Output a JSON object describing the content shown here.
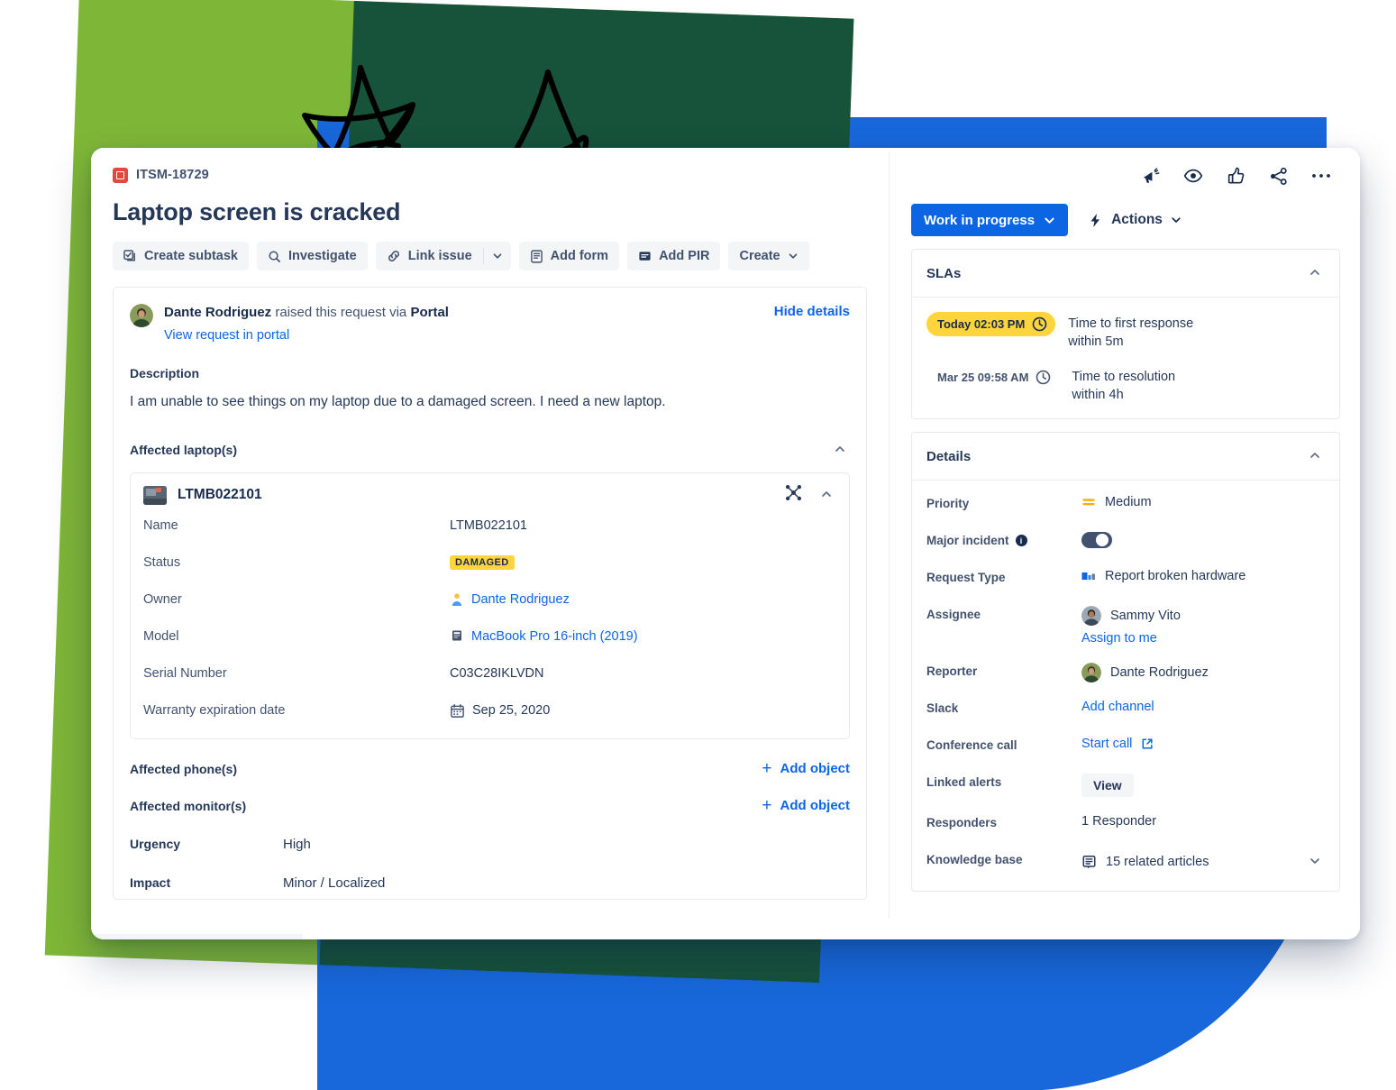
{
  "colors": {
    "green": "#7EB737",
    "green_dark": "#17523A",
    "blue": "#1868DB",
    "accent": "#0C66E4",
    "yellow": "#FFD43D"
  },
  "breadcrumb": {
    "issue_key": "ITSM-18729",
    "icon": "incident-icon"
  },
  "page_title": "Laptop screen is cracked",
  "toolbar": {
    "create_subtask": "Create subtask",
    "investigate": "Investigate",
    "link_issue": "Link issue",
    "link_issue_caret": "chevron-down-icon",
    "add_form": "Add form",
    "add_pir": "Add PIR",
    "create": "Create"
  },
  "request": {
    "reporter_name": "Dante Rodriguez",
    "raised_text": "raised this request via",
    "channel": "Portal",
    "hide_details": "Hide details",
    "view_in_portal": "View request in portal",
    "description_label": "Description",
    "description": "I am unable to see things on my laptop due to a damaged screen. I need a new laptop."
  },
  "affected_laptops": {
    "section_label": "Affected laptop(s)",
    "object_name": "LTMB022101",
    "fields": [
      {
        "key": "Name",
        "value": "LTMB022101",
        "type": "text"
      },
      {
        "key": "Status",
        "value": "DAMAGED",
        "type": "lozenge"
      },
      {
        "key": "Owner",
        "value": "Dante Rodriguez",
        "type": "user-link"
      },
      {
        "key": "Model",
        "value": "MacBook Pro 16-inch (2019)",
        "type": "object-link"
      },
      {
        "key": "Serial Number",
        "value": "C03C28IKLVDN",
        "type": "text"
      },
      {
        "key": "Warranty expiration date",
        "value": "Sep 25, 2020",
        "type": "date"
      }
    ]
  },
  "affected_phones": {
    "label": "Affected phone(s)",
    "add_object": "Add object"
  },
  "affected_monitors": {
    "label": "Affected monitor(s)",
    "add_object": "Add object"
  },
  "urgency": {
    "label": "Urgency",
    "value": "High"
  },
  "impact": {
    "label": "Impact",
    "value": "Minor / Localized"
  },
  "right": {
    "icons": [
      "megaphone-icon",
      "watch-eye-icon",
      "thumbs-up-icon",
      "share-icon",
      "more-actions-icon"
    ],
    "status": "Work in progress",
    "actions": "Actions",
    "slas": {
      "title": "SLAs",
      "items": [
        {
          "time": "Today 02:03 PM",
          "name": "Time to first response",
          "goal": "within 5m",
          "breaching": true
        },
        {
          "time": "Mar 25 09:58 AM",
          "name": "Time to resolution",
          "goal": "within 4h",
          "breaching": false
        }
      ]
    },
    "details": {
      "title": "Details",
      "rows": [
        {
          "key": "Priority",
          "value": "Medium",
          "type": "priority"
        },
        {
          "key": "Major incident",
          "value": "",
          "type": "toggle",
          "info": true
        },
        {
          "key": "Request Type",
          "value": "Report broken hardware",
          "type": "request-type"
        },
        {
          "key": "Assignee",
          "value": "Sammy Vito",
          "type": "user",
          "sub": "Assign to me"
        },
        {
          "key": "Reporter",
          "value": "Dante Rodriguez",
          "type": "user"
        },
        {
          "key": "Slack",
          "value": "Add channel",
          "type": "link"
        },
        {
          "key": "Conference call",
          "value": "Start call",
          "type": "external-link"
        },
        {
          "key": "Linked alerts",
          "value": "View",
          "type": "button"
        },
        {
          "key": "Responders",
          "value": "1 Responder",
          "type": "text"
        },
        {
          "key": "Knowledge base",
          "value": "15 related articles",
          "type": "kb"
        }
      ]
    }
  }
}
